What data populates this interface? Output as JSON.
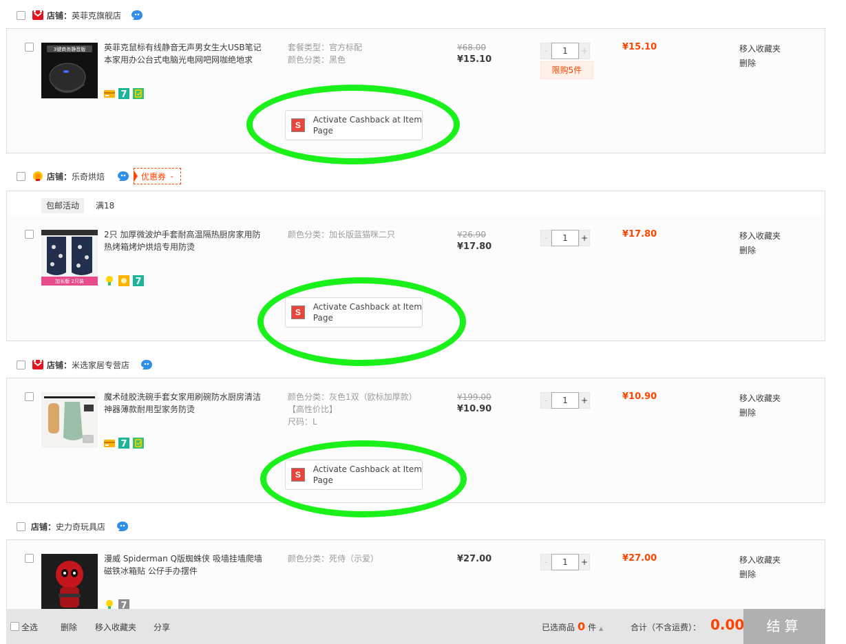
{
  "shops": [
    {
      "prefix": "店铺：",
      "name": "英菲克旗舰店",
      "items": [
        {
          "title": "英菲克鼠标有线静音无声男女生大USB笔记本家用办公台式电脑光电网吧网咖绝地求",
          "props": [
            "套餐类型：官方标配",
            "颜色分类：黑色"
          ],
          "price_old": "¥68.00",
          "price_now": "¥15.10",
          "qty": "1",
          "limit": "限购5件",
          "subtotal": "¥15.10",
          "thumb_text": "3键商务静音版"
        }
      ]
    },
    {
      "prefix": "店铺：",
      "name": "乐奇烘焙",
      "coupon": "优惠券",
      "promo_tag": "包邮活动",
      "promo_text": "满18",
      "items": [
        {
          "title": "2只 加厚微波炉手套耐高温隔热厨房家用防热烤箱烤炉烘焙专用防烫",
          "props": [
            "颜色分类：加长版蓝猫咪二只"
          ],
          "price_old": "¥26.90",
          "price_now": "¥17.80",
          "qty": "1",
          "subtotal": "¥17.80",
          "thumb_text": "加长版 2只装"
        }
      ]
    },
    {
      "prefix": "店铺：",
      "name": "米选家居专营店",
      "items": [
        {
          "title": "魔术硅胶洗碗手套女家用刷碗防水厨房清洁神器薄款耐用型家务防烫",
          "props": [
            "颜色分类：灰色1双（欧标加厚款）",
            "【高性价比】",
            "尺码：L"
          ],
          "price_old": "¥199.00",
          "price_now": "¥10.90",
          "qty": "1",
          "subtotal": "¥10.90"
        }
      ]
    },
    {
      "prefix": "店铺：",
      "name": "史力奇玩具店",
      "items": [
        {
          "title": "漫威 Spiderman Q版蜘蛛侠 吸墙挂墙爬墙磁铁冰箱贴 公仔手办摆件",
          "props": [
            "颜色分类：死侍（示爱）"
          ],
          "price_now": "¥27.00",
          "qty": "1",
          "subtotal": "¥27.00"
        }
      ]
    }
  ],
  "item_ops": {
    "fav": "移入收藏夹",
    "del": "删除"
  },
  "qty_minus": "-",
  "qty_plus": "+",
  "cashback": {
    "badge": "S",
    "label": "Activate Cashback at Item Page"
  },
  "footer": {
    "select_all": "全选",
    "delete": "删除",
    "move_fav": "移入收藏夹",
    "share": "分享",
    "selected_label": "已选商品",
    "selected_count": "0",
    "selected_unit": "件",
    "total_label": "合计（不含运费）：",
    "total": "0.00",
    "checkout": "结算"
  },
  "colors": {
    "accent": "#ff4400",
    "highlight": "#1af11a"
  }
}
